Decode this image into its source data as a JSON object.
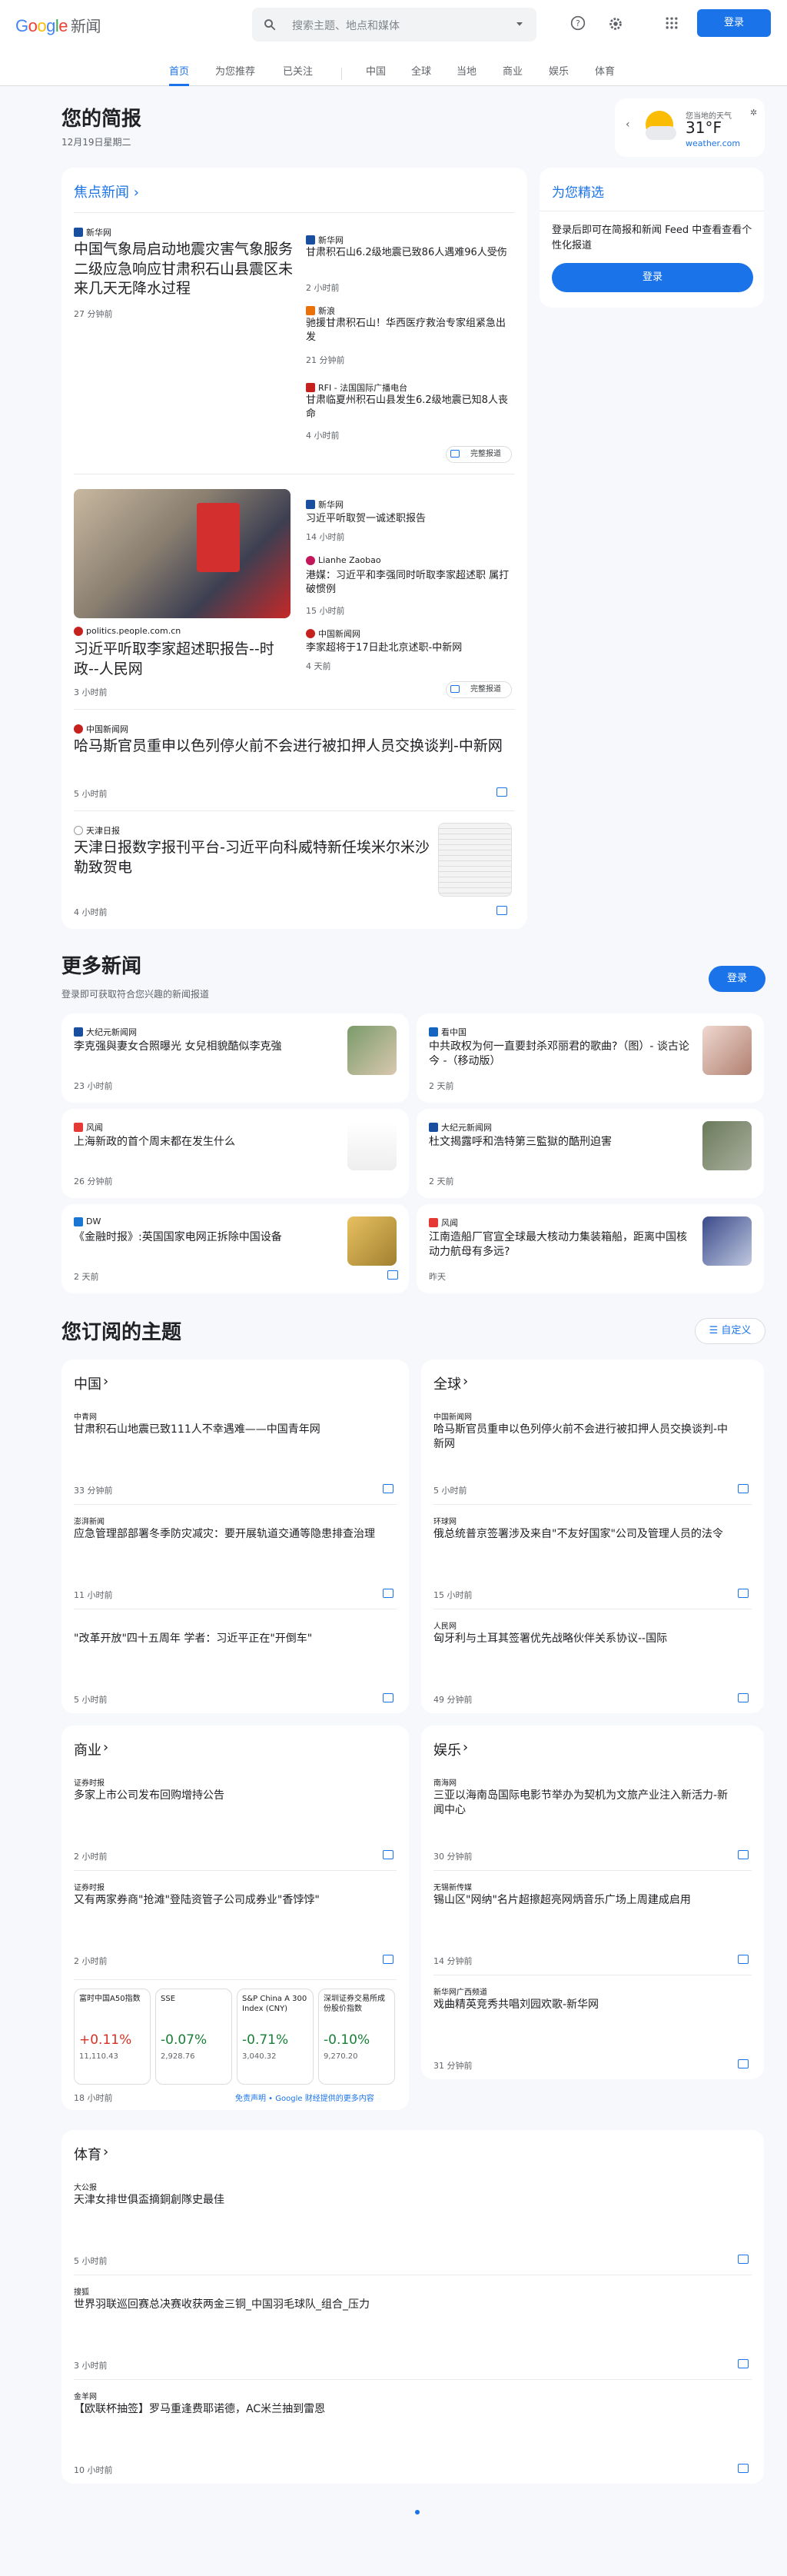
{
  "header": {
    "logo_google": "Google",
    "logo_news": "新闻",
    "search_placeholder": "搜索主题、地点和媒体",
    "login": "登录"
  },
  "tabs": [
    "首页",
    "为您推荐",
    "已关注",
    "中国",
    "全球",
    "当地",
    "商业",
    "娱乐",
    "体育"
  ],
  "brief": {
    "title": "您的简报",
    "date": "12月19日星期二"
  },
  "weather": {
    "label": "您当地的天气",
    "temp": "31°F",
    "link": "weather.com"
  },
  "headlines": {
    "title": "焦点新闻",
    "c1": {
      "src": "新华网",
      "title": "中国气象局启动地震灾害气象服务二级应急响应甘肃积石山县震区未来几天无降水过程",
      "time": "27 分钟前",
      "rel": [
        {
          "src": "新华网",
          "title": "甘肃积石山6.2级地震已致86人遇难96人受伤",
          "time": "2 小时前"
        },
        {
          "src": "新浪",
          "title": "驰援甘肃积石山！华西医疗救治专家组紧急出发",
          "time": "21 分钟前"
        },
        {
          "src": "RFI - 法国国际广播电台",
          "title": "甘肃临夏州积石山县发生6.2级地震已知8人丧命",
          "time": "4 小时前"
        }
      ],
      "full": "完整报道"
    },
    "c2": {
      "src": "politics.people.com.cn",
      "title": "习近平听取李家超述职报告--时政--人民网",
      "time": "3 小时前",
      "rel": [
        {
          "src": "新华网",
          "title": "习近平听取贺一诚述职报告",
          "time": "14 小时前"
        },
        {
          "src": "Lianhe Zaobao",
          "title": "港媒：习近平和李强同时听取李家超述职 属打破惯例",
          "time": "15 小时前"
        },
        {
          "src": "中国新闻网",
          "title": "李家超将于17日赴北京述职-中新网",
          "time": "4 天前"
        }
      ],
      "full": "完整报道"
    },
    "c3": {
      "src": "中国新闻网",
      "title": "哈马斯官员重申以色列停火前不会进行被扣押人员交换谈判-中新网",
      "time": "5 小时前"
    },
    "c4": {
      "src": "天津日报",
      "title": "天津日报数字报刊平台-习近平向科威特新任埃米尔米沙勒致贺电",
      "time": "4 小时前"
    }
  },
  "foryou": {
    "title": "为您精选",
    "desc": "登录后即可在简报和新闻 Feed 中查看查看个性化报道",
    "login": "登录"
  },
  "more": {
    "title": "更多新闻",
    "sub": "登录即可获取符合您兴趣的新闻报道",
    "login": "登录",
    "items": [
      {
        "src": "大纪元新闻网",
        "title": "李克强與妻女合照曝光 女兒相貌酷似李克強",
        "time": "23 小时前"
      },
      {
        "src": "看中国",
        "title": "中共政权为何一直要封杀邓丽君的歌曲?（图）- 谈古论今 -（移动版）",
        "time": "2 天前"
      },
      {
        "src": "风闻",
        "title": "上海新政的首个周末都在发生什么",
        "time": "26 分钟前"
      },
      {
        "src": "大纪元新闻网",
        "title": "杜文揭露呼和浩特第三監獄的酷刑迫害",
        "time": "2 天前"
      },
      {
        "src": "DW",
        "title": "《金融时报》:英国国家电网正拆除中国设备",
        "time": "2 天前"
      },
      {
        "src": "风闻",
        "title": "江南造船厂官宣全球最大核动力集装箱船，距离中国核动力航母有多远?",
        "time": "昨天"
      }
    ]
  },
  "topics": {
    "title": "您订阅的主题",
    "customize": "自定义",
    "china": {
      "title": "中国",
      "items": [
        {
          "src": "中青网",
          "title": "甘肃积石山地震已致111人不幸遇难——中国青年网",
          "time": "33 分钟前"
        },
        {
          "src": "澎湃新闻",
          "title": "应急管理部部署冬季防灾减灾：要开展轨道交通等隐患排查治理",
          "time": "11 小时前"
        },
        {
          "src": "",
          "title": "\"改革开放\"四十五周年 学者：习近平正在\"开倒车\"",
          "time": "5 小时前"
        }
      ]
    },
    "world": {
      "title": "全球",
      "items": [
        {
          "src": "中国新闻网",
          "title": "哈马斯官员重申以色列停火前不会进行被扣押人员交换谈判-中新网",
          "time": "5 小时前"
        },
        {
          "src": "环球网",
          "title": "俄总统普京签署涉及来自\"不友好国家\"公司及管理人员的法令",
          "time": "15 小时前"
        },
        {
          "src": "人民网",
          "title": "匈牙利与土耳其签署优先战略伙伴关系协议--国际",
          "time": "49 分钟前"
        }
      ]
    },
    "business": {
      "title": "商业",
      "items": [
        {
          "src": "证券时报",
          "title": "多家上市公司发布回购增持公告",
          "time": "2 小时前"
        },
        {
          "src": "证券时报",
          "title": "又有两家券商\"抢滩\"登陆资管子公司成券业\"香饽饽\"",
          "time": "2 小时前"
        }
      ],
      "stocks": [
        {
          "name": "富时中国A50指数",
          "chg": "+0.11%",
          "val": "11,110.43",
          "up": true
        },
        {
          "name": "SSE",
          "chg": "-0.07%",
          "val": "2,928.76",
          "up": false
        },
        {
          "name": "S&P China A 300 Index (CNY)",
          "chg": "-0.71%",
          "val": "3,040.32",
          "up": false
        },
        {
          "name": "深圳证券交易所成份股价指数",
          "chg": "-0.10%",
          "val": "9,270.20",
          "up": false
        }
      ],
      "stock_time": "18 小时前",
      "stock_note": "免责声明 • Google 财经提供的更多内容"
    },
    "ent": {
      "title": "娱乐",
      "items": [
        {
          "src": "南海网",
          "title": "三亚以海南岛国际电影节举办为契机为文旅产业注入新活力-新闻中心",
          "time": "30 分钟前"
        },
        {
          "src": "无锡新传媒",
          "title": "锡山区\"网纳\"名片超擦超亮网炳音乐广场上周建成启用",
          "time": "14 分钟前"
        },
        {
          "src": "新华网广西频道",
          "title": "戏曲精英竞秀共唱刘园欢歌-新华网",
          "time": "31 分钟前"
        }
      ]
    },
    "sports": {
      "title": "体育",
      "items": [
        {
          "src": "大公报",
          "title": "天津女排世俱盃摘銅創隊史最佳",
          "time": "5 小时前"
        },
        {
          "src": "搜狐",
          "title": "世界羽联巡回赛总决赛收获两金三铜_中国羽毛球队_组合_压力",
          "time": "3 小时前"
        },
        {
          "src": "金羊网",
          "title": "【欧联杯抽签】罗马重逢费耶诺德，AC米兰抽到雷恩",
          "time": "10 小时前"
        }
      ]
    }
  }
}
